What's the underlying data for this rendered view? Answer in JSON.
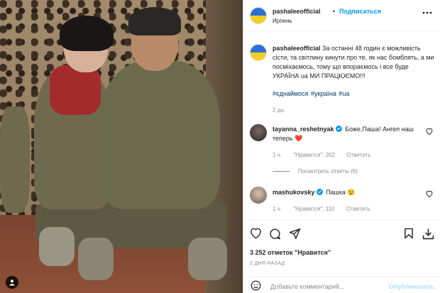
{
  "post": {
    "username": "pashaleeofficial",
    "dot": "•",
    "follow_label": "Подписаться",
    "location": "Ирпень",
    "caption": "За останні 48 годин є можливість сісти, та світлину кинути про те, як нас бомблять, а ми посміхаємось, тому що впораємось і все буде УКРАЇНА ua МИ ПРАЦЮЄМО!!!",
    "hashtags": [
      "#єднаймося",
      "#україна",
      "#ua"
    ],
    "caption_time": "2 дн."
  },
  "comments": [
    {
      "username": "tayanna_reshetnyak",
      "text": "Боже,Паша! Ангел наш теперь",
      "emoji": "❤️",
      "time": "1 ч.",
      "likes": "\"Нравится\": 202",
      "reply_label": "Ответить",
      "view_replies": "Посмотреть ответы (6)"
    },
    {
      "username": "mashukovsky",
      "text": "Пашка",
      "emoji": "😉",
      "time": "1 ч.",
      "likes": "\"Нравится\": 110",
      "reply_label": "Ответить"
    }
  ],
  "stats": {
    "likes_text": "3 252 отметок \"Нравится\"",
    "posted": "2 ДНЯ НАЗАД"
  },
  "composer": {
    "placeholder": "Добавьте комментарий...",
    "publish_label": "Опубликовать"
  },
  "icons": {
    "like": "heart-icon",
    "comment": "comment-icon",
    "share": "share-icon",
    "save": "bookmark-icon",
    "download": "download-icon",
    "emoji": "smiley-icon",
    "more": "more-icon",
    "tag": "user-tag-icon"
  },
  "colors": {
    "accent": "#0095f6",
    "hashtag": "#00376b",
    "muted": "#8e8e8e"
  }
}
